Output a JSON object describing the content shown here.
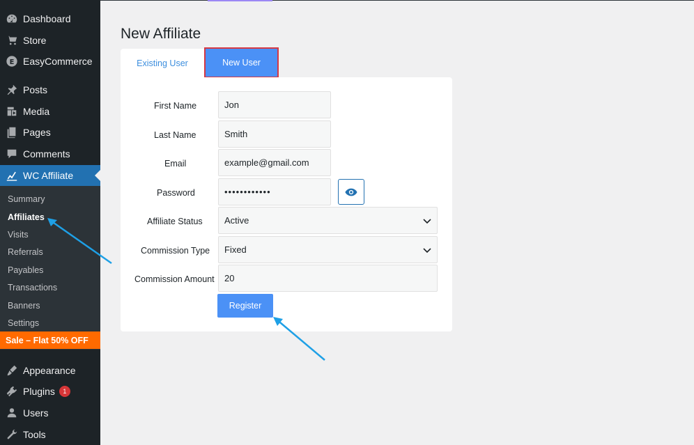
{
  "sidebar": {
    "items": [
      {
        "label": "Dashboard",
        "icon": "dashboard-icon"
      },
      {
        "label": "Store",
        "icon": "cart-icon"
      },
      {
        "label": "EasyCommerce",
        "icon": "easycommerce-icon"
      },
      {
        "label": "Posts",
        "icon": "pin-icon"
      },
      {
        "label": "Media",
        "icon": "media-icon"
      },
      {
        "label": "Pages",
        "icon": "pages-icon"
      },
      {
        "label": "Comments",
        "icon": "comments-icon"
      },
      {
        "label": "WC Affiliate",
        "icon": "chart-line-icon"
      },
      {
        "label": "Appearance",
        "icon": "brush-icon"
      },
      {
        "label": "Plugins",
        "icon": "plug-icon",
        "badge": "1"
      },
      {
        "label": "Users",
        "icon": "user-icon"
      },
      {
        "label": "Tools",
        "icon": "wrench-icon"
      }
    ],
    "submenu": [
      "Summary",
      "Affiliates",
      "Visits",
      "Referrals",
      "Payables",
      "Transactions",
      "Banners",
      "Settings"
    ],
    "sale_label": "Sale – Flat 50% OFF"
  },
  "main": {
    "title": "New Affiliate",
    "tabs": [
      {
        "label": "Existing User"
      },
      {
        "label": "New User"
      }
    ],
    "form": {
      "first_name_label": "First Name",
      "first_name_value": "Jon",
      "last_name_label": "Last Name",
      "last_name_value": "Smith",
      "email_label": "Email",
      "email_value": "example@gmail.com",
      "password_label": "Password",
      "password_value": "••••••••••••",
      "status_label": "Affiliate Status",
      "status_value": "Active",
      "commission_type_label": "Commission Type",
      "commission_type_value": "Fixed",
      "commission_amount_label": "Commission Amount",
      "commission_amount_value": "20",
      "register_label": "Register"
    }
  },
  "colors": {
    "sidebar_bg": "#1d2327",
    "active_menu": "#2271b1",
    "tab_active": "#4b91f6",
    "tab_highlight_border": "#d63843",
    "sale_bg": "#ff6a00",
    "arrow": "#1ea0e6"
  }
}
